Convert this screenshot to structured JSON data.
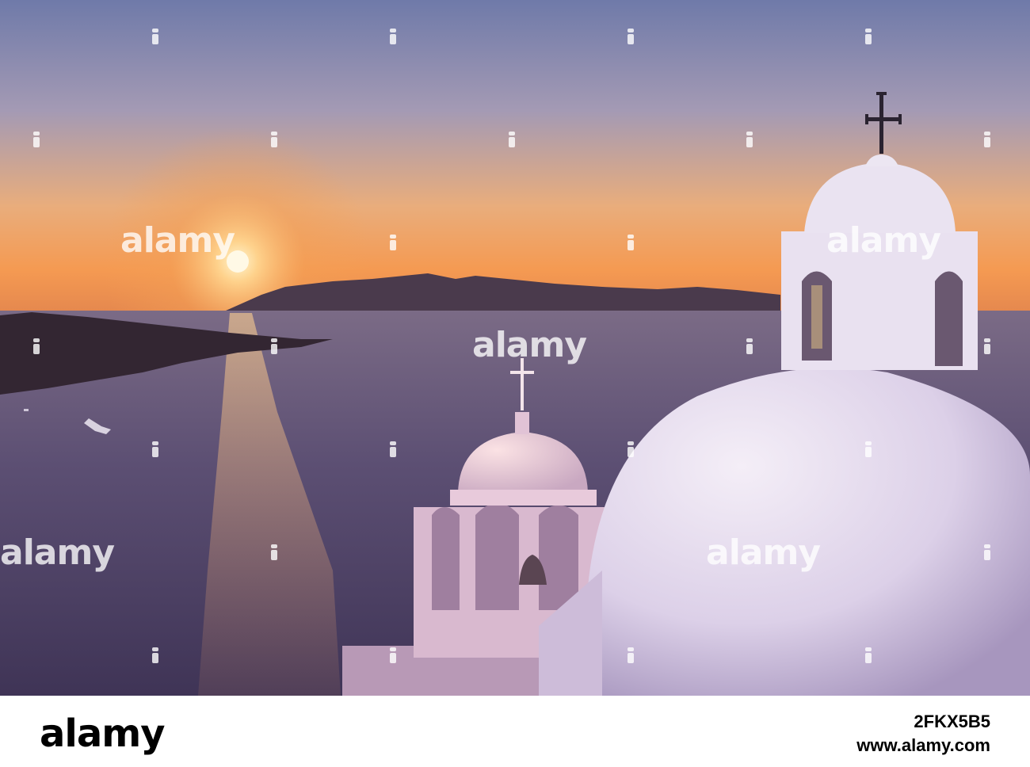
{
  "photo": {
    "subject": "Sunset over Santorini caldera with white church domes and bell towers",
    "palette": {
      "sky_top": "#7d87b3",
      "sky_horizon": "#f6a05a",
      "sun": "#fff2c6",
      "sea": "#5a4f72",
      "island": "#3a2f40",
      "dome": "#e6dcef",
      "dome_shadow": "#b7a9cc"
    }
  },
  "watermark": {
    "text": "alamy"
  },
  "footer": {
    "logo": "alamy",
    "image_id": "2FKX5B5",
    "url": "www.alamy.com"
  }
}
